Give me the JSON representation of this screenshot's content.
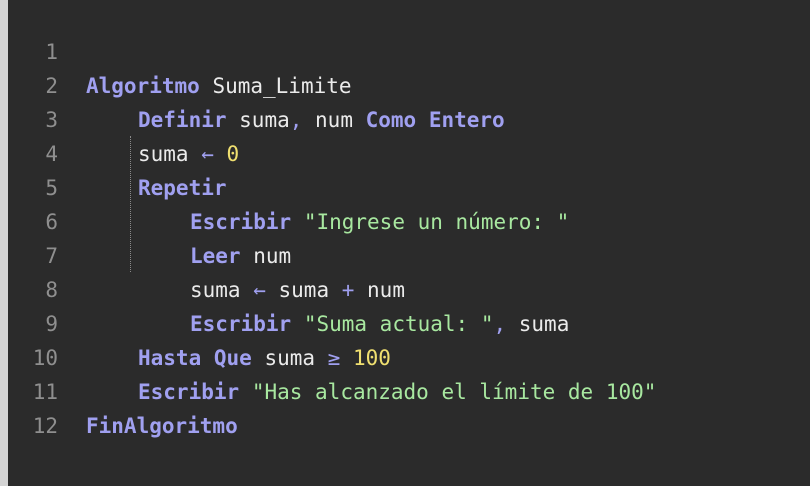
{
  "editor": {
    "lines": [
      {
        "no": "1",
        "tokens": [
          {
            "t": "Algoritmo",
            "c": "kw"
          },
          {
            "t": " ",
            "c": "id"
          },
          {
            "t": "Suma_Limite",
            "c": "id"
          }
        ]
      },
      {
        "no": "2",
        "tokens": [
          {
            "t": "Definir",
            "c": "kw"
          },
          {
            "t": " suma",
            "c": "id"
          },
          {
            "t": ",",
            "c": "punct"
          },
          {
            "t": " num ",
            "c": "id"
          },
          {
            "t": "Como Entero",
            "c": "kw"
          }
        ]
      },
      {
        "no": "3",
        "tokens": [
          {
            "t": "suma ",
            "c": "id"
          },
          {
            "t": "←",
            "c": "op"
          },
          {
            "t": " ",
            "c": "id"
          },
          {
            "t": "0",
            "c": "num"
          }
        ]
      },
      {
        "no": "4",
        "tokens": [
          {
            "t": "Repetir",
            "c": "kw"
          }
        ]
      },
      {
        "no": "5",
        "tokens": [
          {
            "t": "Escribir",
            "c": "kw"
          },
          {
            "t": " ",
            "c": "id"
          },
          {
            "t": "\"Ingrese un número: \"",
            "c": "str"
          }
        ]
      },
      {
        "no": "6",
        "tokens": [
          {
            "t": "Leer",
            "c": "kw"
          },
          {
            "t": " num",
            "c": "id"
          }
        ]
      },
      {
        "no": "7",
        "tokens": [
          {
            "t": "suma ",
            "c": "id"
          },
          {
            "t": "←",
            "c": "op"
          },
          {
            "t": " suma ",
            "c": "id"
          },
          {
            "t": "+",
            "c": "op"
          },
          {
            "t": " num",
            "c": "id"
          }
        ]
      },
      {
        "no": "8",
        "tokens": [
          {
            "t": "Escribir",
            "c": "kw"
          },
          {
            "t": " ",
            "c": "id"
          },
          {
            "t": "\"Suma actual: \"",
            "c": "str"
          },
          {
            "t": ",",
            "c": "punct"
          },
          {
            "t": " suma",
            "c": "id"
          }
        ]
      },
      {
        "no": "9",
        "tokens": [
          {
            "t": "Hasta Que",
            "c": "kw"
          },
          {
            "t": " suma ",
            "c": "id"
          },
          {
            "t": "≥",
            "c": "op"
          },
          {
            "t": " ",
            "c": "id"
          },
          {
            "t": "100",
            "c": "num"
          }
        ]
      },
      {
        "no": "10",
        "tokens": [
          {
            "t": "Escribir",
            "c": "kw"
          },
          {
            "t": " ",
            "c": "id"
          },
          {
            "t": "\"Has alcanzado el límite de 100\"",
            "c": "str"
          }
        ]
      },
      {
        "no": "11",
        "tokens": [
          {
            "t": "FinAlgoritmo",
            "c": "kw"
          }
        ]
      },
      {
        "no": "12",
        "tokens": []
      }
    ]
  }
}
